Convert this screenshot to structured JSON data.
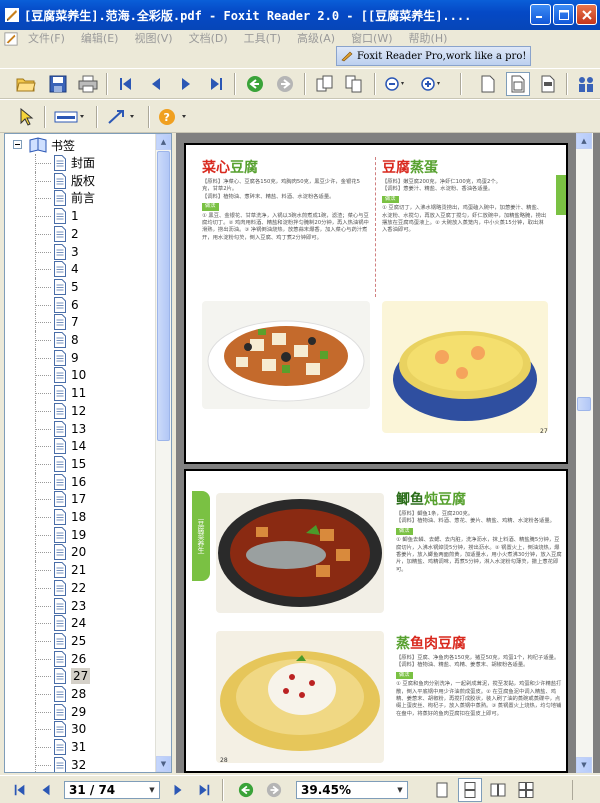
{
  "window": {
    "title": "[豆腐菜养生].范海.全彩版.pdf - Foxit Reader 2.0 - [[豆腐菜养生]...."
  },
  "menu": [
    "文件(F)",
    "编辑(E)",
    "视图(V)",
    "文档(D)",
    "工具(T)",
    "高级(A)",
    "窗口(W)",
    "帮助(H)"
  ],
  "banner": {
    "text": "Foxit Reader Pro,work like a pro!"
  },
  "bookmarks": {
    "root": "书签",
    "items": [
      "封面",
      "版权",
      "前言",
      "1",
      "2",
      "3",
      "4",
      "5",
      "6",
      "7",
      "8",
      "9",
      "10",
      "11",
      "12",
      "13",
      "14",
      "15",
      "16",
      "17",
      "18",
      "19",
      "20",
      "21",
      "22",
      "23",
      "24",
      "25",
      "26",
      "27",
      "28",
      "29",
      "30",
      "31",
      "32"
    ],
    "selected": "27"
  },
  "status": {
    "page": "31 / 74",
    "zoom": "39.45%"
  },
  "pages": {
    "p27": {
      "recipe1_title_a": "菜心",
      "recipe1_title_b": "豆腐",
      "recipe1_ing": "【原料】净菜心、豆腐各150克，鸡胸肉50克，黑豆少许，金银花5克，甘草2片。",
      "recipe1_sea": "【调料】植物油、葱碎末、精盐、料酒、水淀粉各适量。",
      "recipe1_tag": "做法",
      "recipe1_steps": "① 黑豆、金银花、甘草洗净，入锅以3碗水煎煮成1碗，滤渣；菜心与豆腐均切丁。② 鸡肉用料酒、精盐和淀粉拌匀腌制20分钟，再入热油锅中滑熟，捞出沥油。③ 净锅倒油烧热，放葱蒜末爆香，加入菜心与药汁煮开，用水淀粉勾芡，倒入豆腐、鸡丁煮2分钟即可。",
      "recipe2_title_a": "豆腐",
      "recipe2_title_b": "蒸蛋",
      "recipe2_ing": "【原料】嫩豆腐200克，净虾仁100克，鸡蛋2个。",
      "recipe2_sea": "【调料】葱姜汁、精盐、水淀粉、香油各适量。",
      "recipe2_tag": "做法",
      "recipe2_steps": "① 豆腐切丁，入沸水锅略烫捞出，鸡蛋磕入碗中，加葱姜汁、精盐、水淀粉、水搅匀，再放入豆腐丁搅匀，虾仁放碗中，加精盐略腌，捞出摆放在豆腐鸡蛋液上。② 大碗放入蒸笼内，中小火蒸15分钟，取出淋入香油即可。",
      "number": "27"
    },
    "p28": {
      "sidetab": "豆腐菜养生",
      "recipe3_title_a": "鲫鱼",
      "recipe3_title_b": "炖豆腐",
      "recipe3_ing": "【原料】鲫鱼1条，豆腐200克。",
      "recipe3_sea": "【调料】植物油、料酒、葱花、姜片、精盐、鸡精、水淀粉各适量。",
      "recipe3_tag": "做法",
      "recipe3_steps": "① 鲫鱼去鳞、去鳃、去内脏，洗净沥水，抹上料酒、精盐腌5分钟，豆腐切片，入沸水锅焯烫5分钟，捞出沥水。② 锅置火上，倒油烧热，爆香姜片，放入鲫鱼两面煎黄，加适量水，用小火煮沸30分钟，放入豆腐片，加精盐、鸡精调味，再煮5分钟，淋入水淀粉勾薄芡，撒上葱花即可。",
      "recipe4_title_a": "蒸",
      "recipe4_title_b": "鱼肉豆腐",
      "recipe4_ing": "【原料】豆腐、净鱼肉各150克，猪豆50克，鸡蛋1个，枸杞子适量。",
      "recipe4_sea": "【调料】植物油、精盐、鸡精、姜葱末、胡椒粉各适量。",
      "recipe4_tag": "做法",
      "recipe4_steps": "① 豆腐和鱼肉分别洗净，一起剁成茸泥，搅至发黏，鸡蛋和少许精盐打散，倒入平底锅中用少许油煎成蛋皮。② 在豆腐鱼泥中调入精盐、鸡精、姜葱末、胡椒粉，再搅打成胶状，装入刷了油的蒸碗或蒸碟中，点缀上蛋皮丝、枸杞子，放入蒸锅中蒸熟。③ 蒸锅置火上烧热，均匀地铺在盘中，将蒸好的鱼肉豆腐扣在蛋皮上即可。",
      "number": "28"
    }
  }
}
